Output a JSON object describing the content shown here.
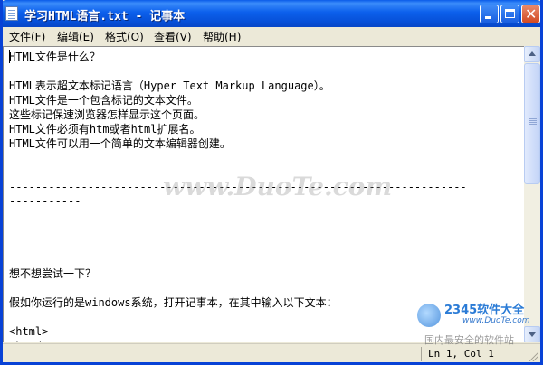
{
  "window": {
    "title": "学习HTML语言.txt - 记事本"
  },
  "menu": {
    "items": [
      {
        "label": "文件(F)"
      },
      {
        "label": "编辑(E)"
      },
      {
        "label": "格式(O)"
      },
      {
        "label": "查看(V)"
      },
      {
        "label": "帮助(H)"
      }
    ]
  },
  "editor": {
    "content": "HTML文件是什么？\n\nHTML表示超文本标记语言（Hyper Text Markup Language）。\nHTML文件是一个包含标记的文本文件。\n这些标记保速浏览器怎样显示这个页面。\nHTML文件必须有htm或者html扩展名。\nHTML文件可以用一个简单的文本编辑器创建。\n\n\n----------------------------------------------------------------------\n-----------\n\n\n\n\n想不想尝试一下？\n\n假如你运行的是windows系统，打开记事本，在其中输入以下文本：\n\n<html>\n<head>"
  },
  "statusbar": {
    "position": "Ln 1, Col 1"
  },
  "overlays": {
    "watermark": "www.DuoTe.com",
    "brand_name": "2345软件大全",
    "brand_url": "www.DuoTe.com",
    "brand_slogan": "国内最安全的软件站"
  }
}
